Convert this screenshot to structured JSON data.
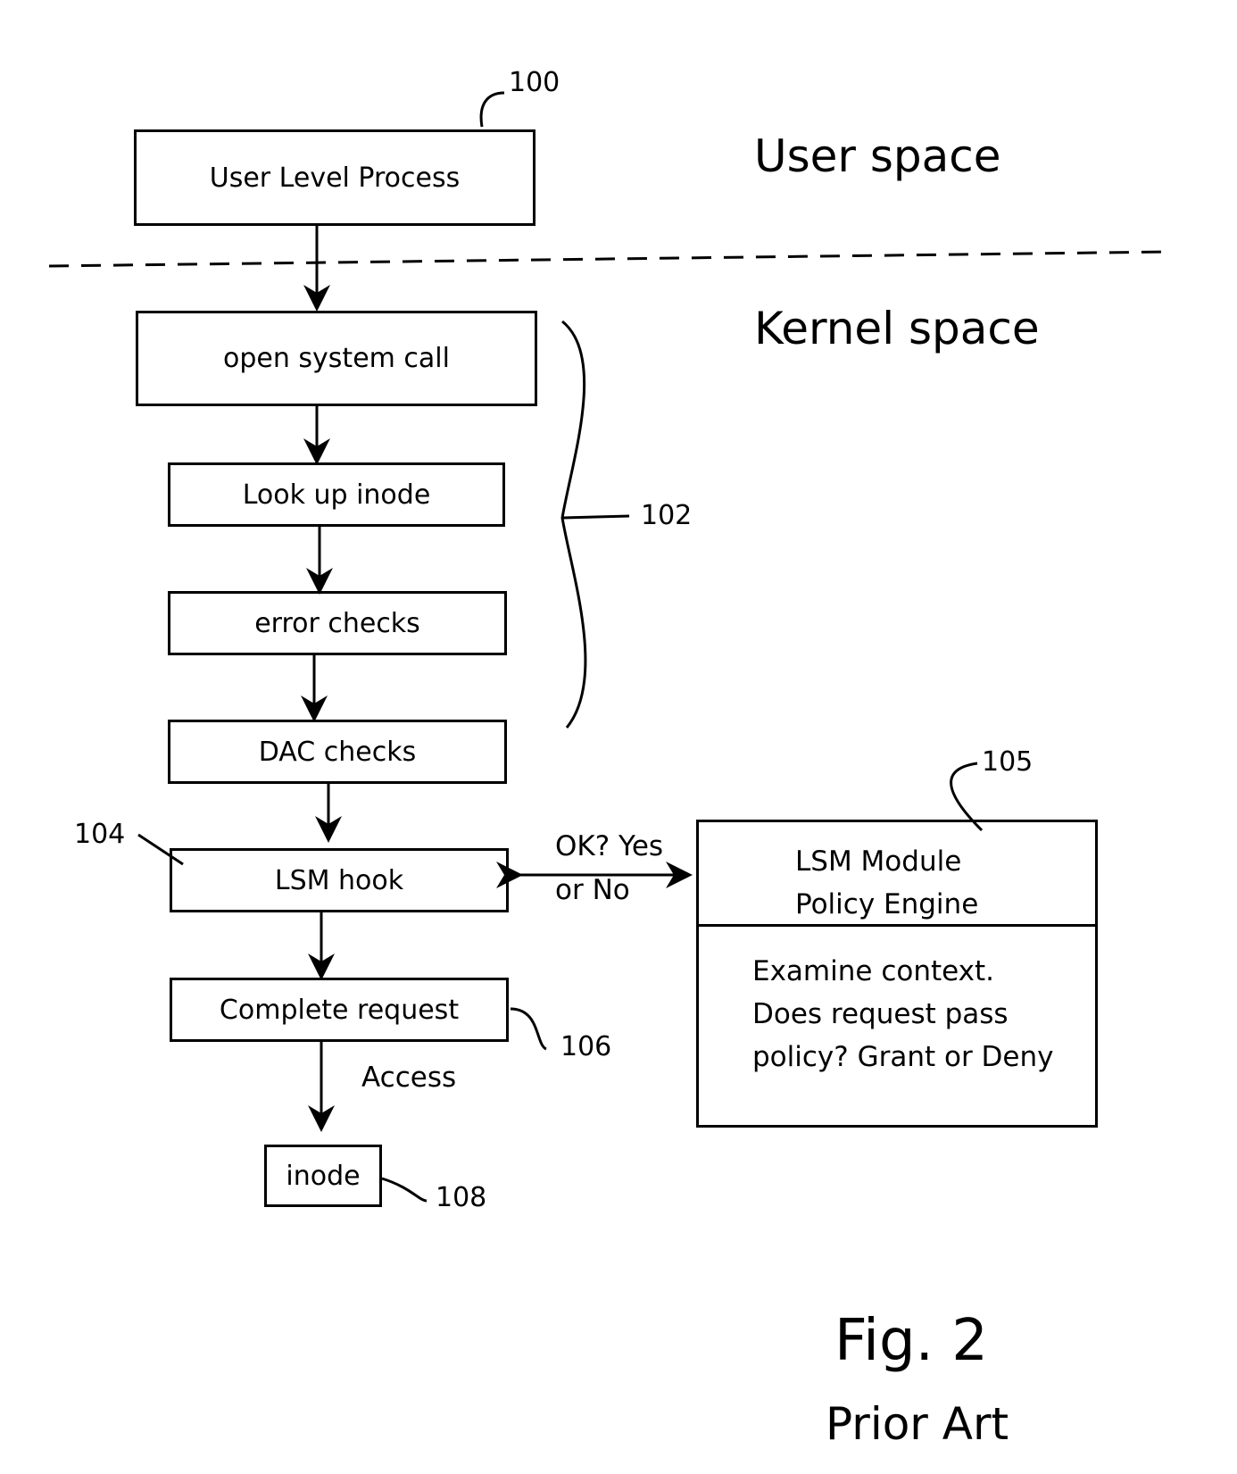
{
  "regions": {
    "user": "User space",
    "kernel": "Kernel space"
  },
  "boxes": {
    "user_process": "User Level Process",
    "open_call": "open system call",
    "lookup": "Look up inode",
    "error_checks": "error checks",
    "dac": "DAC checks",
    "lsm_hook": "LSM hook",
    "complete": "Complete request",
    "inode": "inode"
  },
  "module": {
    "title1": "LSM Module",
    "title2": "Policy Engine",
    "body1": "Examine context.",
    "body2": "Does request pass",
    "body3": "policy? Grant or Deny"
  },
  "edges": {
    "ok1": "OK? Yes",
    "ok2": "or No",
    "access": "Access"
  },
  "refs": {
    "r100": "100",
    "r102": "102",
    "r104": "104",
    "r105": "105",
    "r106": "106",
    "r108": "108"
  },
  "caption": {
    "fig": "Fig. 2",
    "sub": "Prior Art"
  }
}
